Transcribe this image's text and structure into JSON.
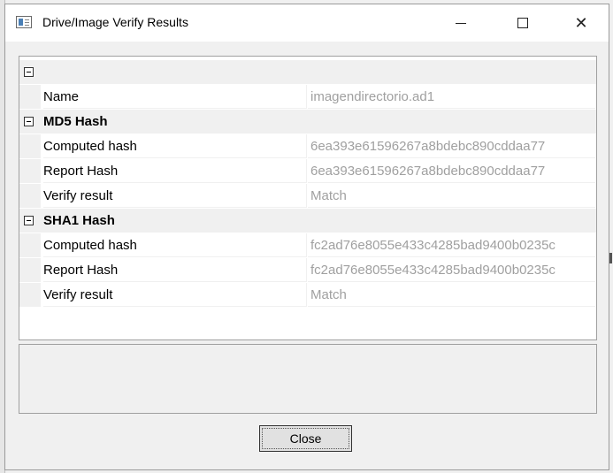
{
  "window": {
    "title": "Drive/Image Verify Results",
    "close_symbol": "✕"
  },
  "grid": {
    "rows": [
      {
        "kind": "category",
        "label": ""
      },
      {
        "kind": "property",
        "name": "Name",
        "value": "imagendirectorio.ad1"
      },
      {
        "kind": "category",
        "label": "MD5 Hash"
      },
      {
        "kind": "property",
        "name": "Computed hash",
        "value": "6ea393e61596267a8bdebc890cddaa77"
      },
      {
        "kind": "property",
        "name": "Report Hash",
        "value": "6ea393e61596267a8bdebc890cddaa77"
      },
      {
        "kind": "property",
        "name": "Verify result",
        "value": "Match"
      },
      {
        "kind": "category",
        "label": "SHA1 Hash"
      },
      {
        "kind": "property",
        "name": "Computed hash",
        "value": "fc2ad76e8055e433c4285bad9400b0235c"
      },
      {
        "kind": "property",
        "name": "Report Hash",
        "value": "fc2ad76e8055e433c4285bad9400b0235c"
      },
      {
        "kind": "property",
        "name": "Verify result",
        "value": "Match"
      }
    ]
  },
  "footer": {
    "close_label": "Close"
  }
}
